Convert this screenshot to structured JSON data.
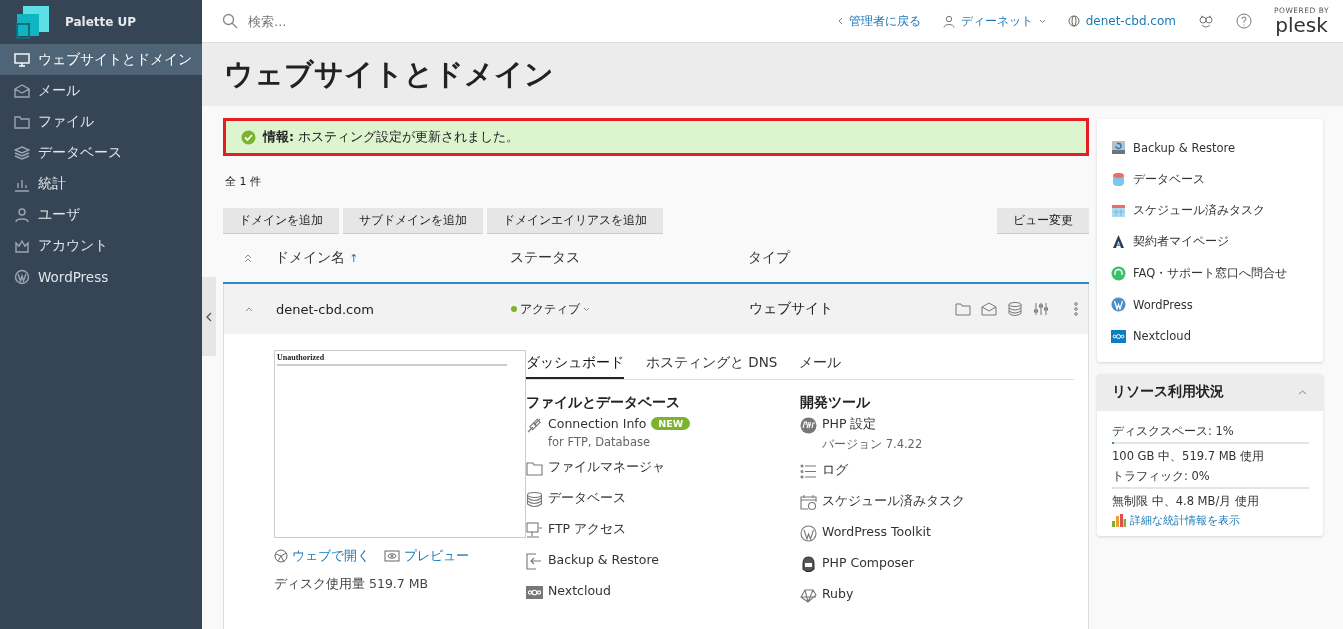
{
  "brand": {
    "name": "Palette UP"
  },
  "sidebar": {
    "items": [
      {
        "label": "ウェブサイトとドメイン",
        "selected": true
      },
      {
        "label": "メール",
        "selected": false
      },
      {
        "label": "ファイル",
        "selected": false
      },
      {
        "label": "データベース",
        "selected": false
      },
      {
        "label": "統計",
        "selected": false
      },
      {
        "label": "ユーザ",
        "selected": false
      },
      {
        "label": "アカウント",
        "selected": false
      },
      {
        "label": "WordPress",
        "selected": false
      }
    ]
  },
  "topbar": {
    "search_placeholder": "検索...",
    "back": "管理者に戻る",
    "user": "ディーネット",
    "domain": "denet-cbd.com",
    "plesk_powered": "POWERED BY",
    "plesk": "plesk"
  },
  "page_title": "ウェブサイトとドメイン",
  "message": {
    "label": "情報:",
    "text": "ホスティング設定が更新されました。"
  },
  "count": "全 1 件",
  "actions": [
    "ドメインを追加",
    "サブドメインを追加",
    "ドメインエイリアスを追加"
  ],
  "view_button": "ビュー変更",
  "table": {
    "columns": [
      "ドメイン名",
      "ステータス",
      "タイプ"
    ],
    "sort_mark": "↑"
  },
  "domain": {
    "name": "denet-cbd.com",
    "expanded": true,
    "status": "アクティブ",
    "type": "ウェブサイト",
    "preview": {
      "title": "Unauthorized"
    },
    "links": [
      "ウェブで開く",
      "プレビュー"
    ],
    "disk": "ディスク使用量 519.7 MB",
    "tabs": [
      {
        "label": "ダッシュボード",
        "selected": true
      },
      {
        "label": "ホスティングと DNS",
        "selected": false
      },
      {
        "label": "メール",
        "selected": false
      }
    ],
    "groups": [
      {
        "title": "ファイルとデータベース",
        "items": [
          {
            "label": "Connection Info",
            "badge": "NEW",
            "sub": "for FTP, Database"
          },
          {
            "label": "ファイルマネージャ"
          },
          {
            "label": "データベース"
          },
          {
            "label": "FTP アクセス"
          },
          {
            "label": "Backup & Restore"
          },
          {
            "label": "Nextcloud"
          }
        ]
      },
      {
        "title": "開発ツール",
        "items": [
          {
            "label": "PHP 設定",
            "sub": "バージョン 7.4.22"
          },
          {
            "label": "ログ"
          },
          {
            "label": "スケジュール済みタスク"
          },
          {
            "label": "WordPress Toolkit"
          },
          {
            "label": "PHP Composer"
          },
          {
            "label": "Ruby"
          }
        ]
      }
    ]
  },
  "side_links": [
    "Backup & Restore",
    "データベース",
    "スケジュール済みタスク",
    "契約者マイページ",
    "FAQ・サポート窓口へ問合せ",
    "WordPress",
    "Nextcloud"
  ],
  "resources": {
    "title": "リソース利用状況",
    "meters": [
      {
        "label": "ディスクスペース: 1%",
        "level": 0.01,
        "detail": "100 GB 中、519.7 MB 使用"
      },
      {
        "label": "トラフィック: 0%",
        "level": 0,
        "detail": "無制限 中、4.8 MB/月 使用"
      }
    ],
    "link": "詳細な統計情報を表示"
  }
}
